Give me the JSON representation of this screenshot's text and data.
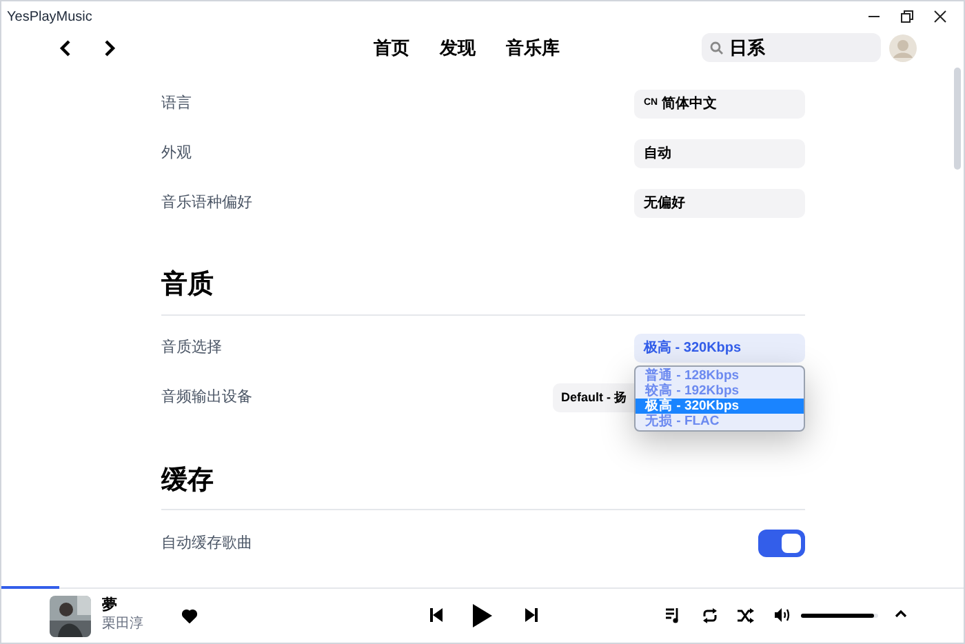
{
  "window": {
    "title": "YesPlayMusic"
  },
  "nav": {
    "links": [
      {
        "label": "首页",
        "selected": false
      },
      {
        "label": "发现",
        "selected": false
      },
      {
        "label": "音乐库",
        "selected": false
      }
    ],
    "search": {
      "value": "日系"
    }
  },
  "sections": [
    {
      "rows": [
        {
          "label": "语言",
          "kind": "select",
          "value": "简体中文",
          "badge": "CN"
        },
        {
          "label": "外观",
          "kind": "select",
          "value": "自动"
        },
        {
          "label": "音乐语种偏好",
          "kind": "select",
          "value": "无偏好"
        }
      ]
    },
    {
      "title": "音质",
      "rows": [
        {
          "label": "音质选择",
          "kind": "select",
          "value": "极高 - 320Kbps",
          "focused": true
        },
        {
          "label": "音频输出设备",
          "kind": "select",
          "value": "Default - 扬"
        }
      ]
    },
    {
      "title": "缓存",
      "rows": [
        {
          "label": "自动缓存歌曲",
          "kind": "toggle",
          "on": true
        }
      ]
    }
  ],
  "dropdown": {
    "options": [
      {
        "label": "普通 - 128Kbps",
        "selected": false
      },
      {
        "label": "较高 - 192Kbps",
        "selected": false
      },
      {
        "label": "极高 - 320Kbps",
        "selected": true
      },
      {
        "label": "无损 - FLAC",
        "selected": false
      }
    ]
  },
  "player": {
    "progress": {
      "level": 0.06
    },
    "title": "夢",
    "artist": "栗田淳",
    "liked": true,
    "volume": {
      "level": 0.95
    }
  }
}
